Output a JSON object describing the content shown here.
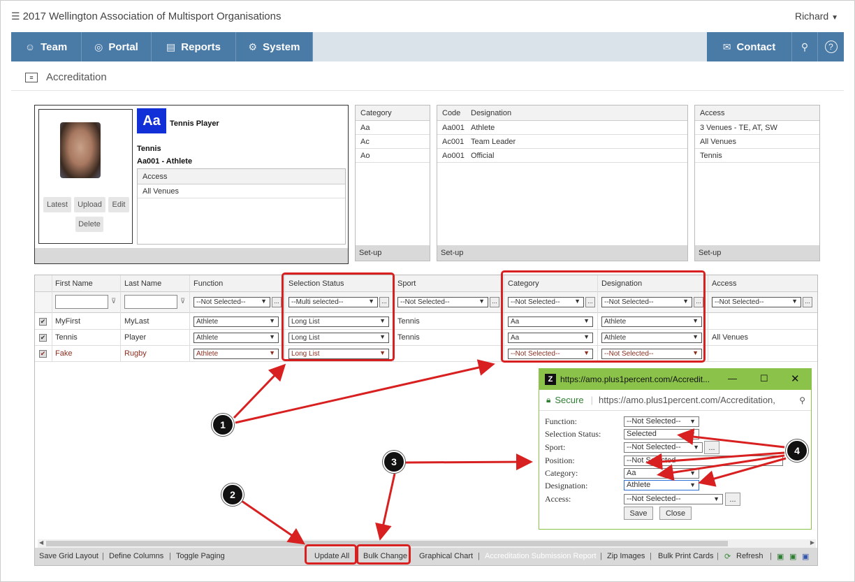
{
  "app": {
    "title": "2017 Wellington Association of Multisport Organisations",
    "user": "Richard"
  },
  "nav": {
    "tabs": [
      "Team",
      "Portal",
      "Reports",
      "System"
    ],
    "contact": "Contact"
  },
  "page": {
    "title": "Accreditation"
  },
  "card": {
    "badge": "Aa",
    "category_name": "Tennis Player",
    "sport": "Tennis",
    "code_desig": "Aa001 - Athlete",
    "access_header": "Access",
    "access_value": "All Venues",
    "buttons": {
      "latest": "Latest",
      "upload": "Upload",
      "edit": "Edit",
      "delete": "Delete"
    }
  },
  "category_panel": {
    "header": "Category",
    "rows": [
      "Aa",
      "Ac",
      "Ao"
    ],
    "footer": "Set-up"
  },
  "designation_panel": {
    "code_header": "Code",
    "desig_header": "Designation",
    "rows": [
      {
        "code": "Aa001",
        "name": "Athlete"
      },
      {
        "code": "Ac001",
        "name": "Team Leader"
      },
      {
        "code": "Ao001",
        "name": "Official"
      }
    ],
    "footer": "Set-up"
  },
  "access_panel": {
    "header": "Access",
    "rows": [
      "3 Venues - TE, AT, SW",
      "All Venues",
      "Tennis"
    ],
    "footer": "Set-up"
  },
  "grid": {
    "columns": [
      "First Name",
      "Last Name",
      "Function",
      "Selection Status",
      "Sport",
      "Category",
      "Designation",
      "Access"
    ],
    "filters": {
      "function": "--Not Selected--",
      "status": "--Multi selected--",
      "sport": "--Not Selected--",
      "category": "--Not Selected--",
      "designation": "--Not Selected--",
      "access": "--Not Selected--"
    },
    "rows": [
      {
        "first": "MyFirst",
        "last": "MyLast",
        "function": "Athlete",
        "status": "Long List",
        "sport": "Tennis",
        "category": "Aa",
        "designation": "Athlete",
        "access": ""
      },
      {
        "first": "Tennis",
        "last": "Player",
        "function": "Athlete",
        "status": "Long List",
        "sport": "Tennis",
        "category": "Aa",
        "designation": "Athlete",
        "access": "All Venues"
      },
      {
        "first": "Fake",
        "last": "Rugby",
        "function": "Athlete",
        "status": "Long List",
        "sport": "",
        "category": "--Not Selected--",
        "designation": "--Not Selected--",
        "access": ""
      }
    ]
  },
  "toolbar": {
    "save_grid": "Save Grid Layout",
    "define_columns": "Define Columns",
    "toggle_paging": "Toggle Paging",
    "update_all": "Update All",
    "bulk_change": "Bulk Change",
    "graphical_chart": "Graphical Chart",
    "submission_report": "Accreditation Submission Report",
    "zip_images": "Zip Images",
    "bulk_print": "Bulk Print Cards",
    "refresh": "Refresh"
  },
  "popup": {
    "title": "https://amo.plus1percent.com/Accredit...",
    "secure": "Secure",
    "url": "https://amo.plus1percent.com/Accreditation,",
    "fields": [
      {
        "label": "Function:",
        "value": "--Not Selected--"
      },
      {
        "label": "Selection Status:",
        "value": "Selected"
      },
      {
        "label": "Sport:",
        "value": "--Not Selected--"
      },
      {
        "label": "Position:",
        "value": "--Not Selected--"
      },
      {
        "label": "Category:",
        "value": "Aa"
      },
      {
        "label": "Designation:",
        "value": "Athlete"
      },
      {
        "label": "Access:",
        "value": "--Not Selected--"
      }
    ],
    "save": "Save",
    "close": "Close",
    "more": "..."
  },
  "callouts": [
    "1",
    "2",
    "3",
    "4"
  ],
  "colors": {
    "nav": "#4a7aa6",
    "badge": "#1230d8",
    "annotation": "#d92020",
    "popup_chrome": "#8bc34a"
  }
}
